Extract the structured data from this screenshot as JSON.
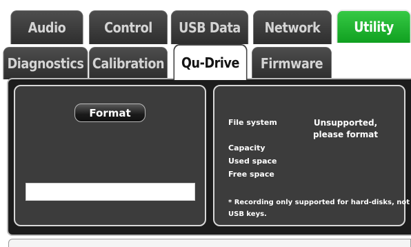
{
  "top_tabs": [
    {
      "label": "Audio"
    },
    {
      "label": "Control"
    },
    {
      "label": "USB Data"
    },
    {
      "label": "Network"
    },
    {
      "label": "Utility"
    }
  ],
  "sub_tabs": [
    {
      "label": "Diagnostics"
    },
    {
      "label": "Calibration"
    },
    {
      "label": "Qu-Drive"
    },
    {
      "label": "Firmware"
    }
  ],
  "format_panel": {
    "format_button": "Format"
  },
  "info_panel": {
    "file_system_label": "File system",
    "file_system_value_line1": "Unsupported,",
    "file_system_value_line2": "please format",
    "capacity_label": "Capacity",
    "used_space_label": "Used space",
    "free_space_label": "Free space",
    "note_line1": "* Recording only supported for hard-disks, not",
    "note_line2": "USB keys."
  },
  "colors": {
    "active_tab": "#1fb532",
    "panel_bg": "#3c3c3c",
    "background": "#1c1c1c"
  }
}
